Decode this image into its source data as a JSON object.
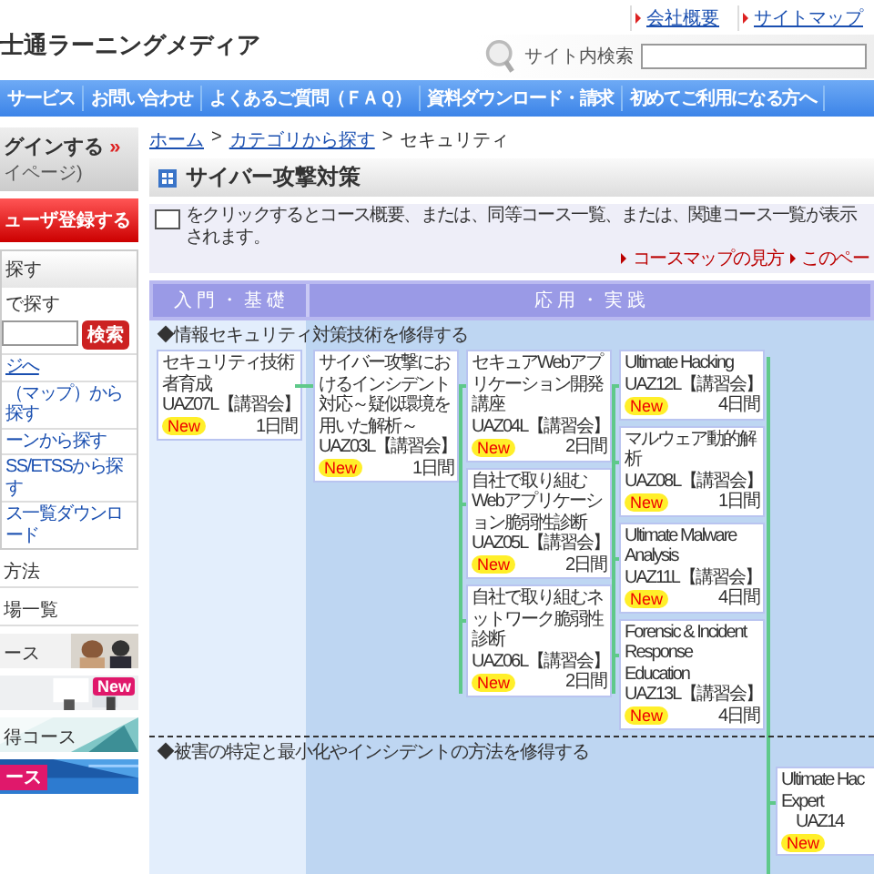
{
  "header": {
    "logo": "士通ラーニングメディア",
    "top_links": [
      "会社概要",
      "サイトマップ"
    ],
    "search": {
      "label": "サイト内検索"
    }
  },
  "nav": [
    "サービス",
    "お問い合わせ",
    "よくあるご質問（ＦＡＱ）",
    "資料ダウンロード・請求",
    "初めてご利用になる方へ"
  ],
  "sidebar": {
    "login": {
      "label": "グインする",
      "mark": "»",
      "sub": "イページ)"
    },
    "register": "ューザ登録する",
    "search_box": {
      "title": "探す",
      "label": "で探す",
      "button": "検索"
    },
    "links": [
      "ジへ",
      "（マップ）から探す",
      "ーンから探す",
      "SS/ETSSから探す",
      "ス一覧ダウンロード"
    ],
    "items": [
      "方法",
      "場一覧"
    ],
    "banners": [
      {
        "text": "ース"
      },
      {
        "badge": "New"
      },
      {
        "text": "得コース"
      },
      {
        "tag": "ース"
      }
    ]
  },
  "breadcrumb": [
    {
      "kind": "link",
      "text": "ホーム"
    },
    {
      "kind": "sep",
      "text": ">"
    },
    {
      "kind": "link",
      "text": "カテゴリから探す"
    },
    {
      "kind": "sep",
      "text": ">"
    },
    {
      "kind": "current",
      "text": "セキュリティ"
    }
  ],
  "page_title": "サイバー攻撃対策",
  "hint": {
    "text": "をクリックするとコース概要、または、同等コース一覧、または、関連コース一覧が表示されます。",
    "links": [
      "コースマップの見方",
      "このペー"
    ]
  },
  "map": {
    "headers": [
      "入 門 ・ 基 礎",
      "応 用 ・ 実 践"
    ],
    "sections": [
      {
        "label": "◆情報セキュリティ対策技術を修得する",
        "columns": [
          [
            {
              "title": "セキュリティ技術者育成",
              "code": "UAZ07L【講習会】",
              "badge": "New",
              "days": "1日間"
            }
          ],
          [
            {
              "title": "サイバー攻撃におけるインシデント対応～疑似環境を用いた解析～",
              "code": "UAZ03L【講習会】",
              "badge": "New",
              "days": "1日間"
            }
          ],
          [
            {
              "title": "セキュアWebアプリケーション開発講座",
              "code": "UAZ04L【講習会】",
              "badge": "New",
              "days": "2日間"
            },
            {
              "title": "自社で取り組むWebアプリケーション脆弱性診断",
              "code": "UAZ05L【講習会】",
              "badge": "New",
              "days": "2日間"
            },
            {
              "title": "自社で取り組むネットワーク脆弱性診断",
              "code": "UAZ06L【講習会】",
              "badge": "New",
              "days": "2日間"
            }
          ],
          [
            {
              "title": "Ultimate Hacking",
              "code": "UAZ12L【講習会】",
              "badge": "New",
              "days": "4日間"
            },
            {
              "title": "マルウェア動的解析",
              "code": "UAZ08L【講習会】",
              "badge": "New",
              "days": "1日間"
            },
            {
              "title": "Ultimate Malware Analysis",
              "code": "UAZ11L【講習会】",
              "badge": "New",
              "days": "4日間"
            },
            {
              "title": "Forensic & Incident Response Education",
              "code": "UAZ13L【講習会】",
              "badge": "New",
              "days": "4日間"
            }
          ],
          []
        ]
      },
      {
        "label": "◆被害の特定と最小化やインシデントの方法を修得する",
        "columns": [
          [],
          [],
          [],
          [],
          [
            {
              "title": "Ultimate Hac\nExpert",
              "code": "UAZ14",
              "badge": "New"
            }
          ]
        ]
      }
    ]
  }
}
